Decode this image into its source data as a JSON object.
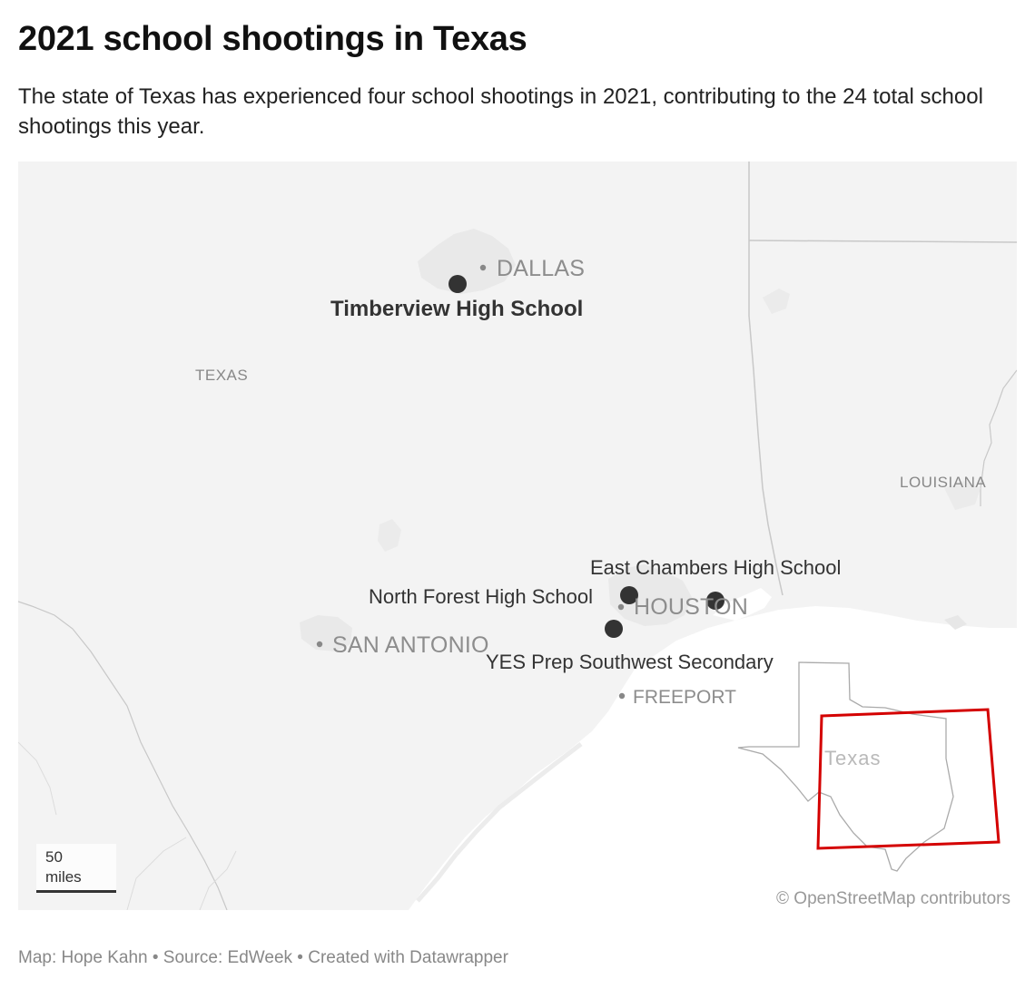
{
  "title": "2021 school shootings in Texas",
  "subtitle": "The state of Texas has experienced four school shootings in 2021, contributing to the 24 total school shootings this year.",
  "map": {
    "region_labels": {
      "texas": "TEXAS",
      "louisiana": "LOUISIANA"
    },
    "cities": {
      "dallas": "DALLAS",
      "houston": "HOUSTON",
      "san_antonio": "SAN ANTONIO",
      "freeport": "FREEPORT"
    },
    "schools": {
      "timberview": "Timberview High School",
      "east_chambers": "East Chambers High School",
      "north_forest": "North Forest High School",
      "yes_prep": "YES Prep Southwest Secondary"
    },
    "inset_label": "Texas",
    "scale": {
      "value": "50",
      "unit": "miles"
    },
    "attribution": "© OpenStreetMap contributors",
    "colors": {
      "land": "#f3f3f3",
      "water": "#ffffff",
      "marker": "#333333",
      "inset_frame": "#d40000"
    }
  },
  "footer": "Map: Hope Kahn • Source: EdWeek • Created with Datawrapper"
}
